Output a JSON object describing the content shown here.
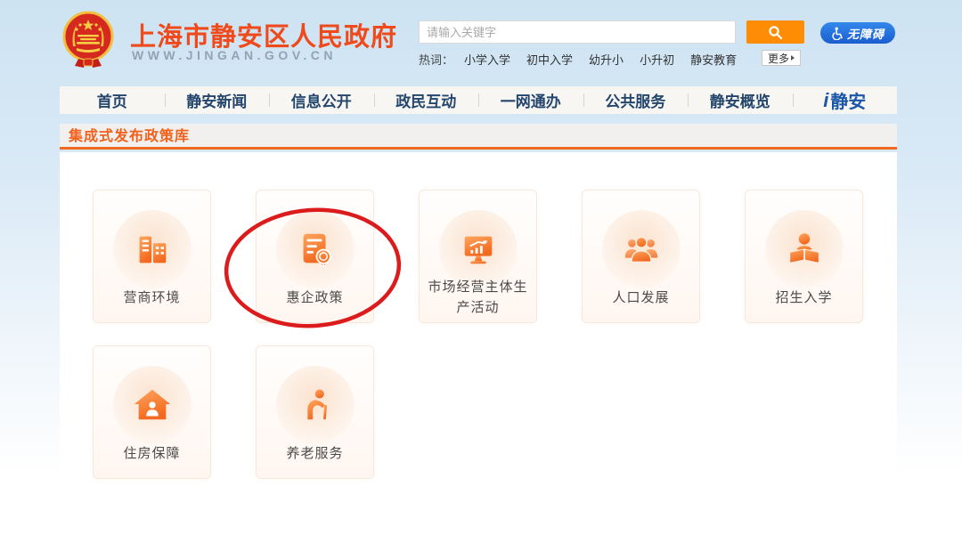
{
  "header": {
    "site_title": "上海市静安区人民政府",
    "site_url": "WWW.JINGAN.GOV.CN",
    "search": {
      "placeholder": "请输入关键字",
      "more_label": "更多"
    },
    "hot_words": {
      "label": "热词：",
      "items": [
        "小学入学",
        "初中入学",
        "幼升小",
        "小升初",
        "静安教育"
      ]
    },
    "accessibility_label": "无障碍"
  },
  "nav": {
    "items": [
      "首页",
      "静安新闻",
      "信息公开",
      "政民互动",
      "一网通办",
      "公共服务",
      "静安概览"
    ],
    "logo_prefix": "i",
    "logo_text": "静安"
  },
  "section": {
    "title": "集成式发布政策库"
  },
  "cards": [
    {
      "label": "营商环境",
      "icon": "buildings-icon"
    },
    {
      "label": "惠企政策",
      "icon": "policy-document-icon",
      "highlighted": true
    },
    {
      "label": "市场经营主体生产活动",
      "icon": "monitor-chart-icon"
    },
    {
      "label": "人口发展",
      "icon": "people-group-icon"
    },
    {
      "label": "招生入学",
      "icon": "student-reading-icon"
    },
    {
      "label": "住房保障",
      "icon": "house-person-icon"
    },
    {
      "label": "养老服务",
      "icon": "elderly-care-icon"
    }
  ],
  "colors": {
    "accent_orange": "#ef6a1e",
    "title_red": "#ef4a1b",
    "nav_text": "#24466c",
    "accessibility_blue": "#1a5ecf",
    "highlight_circle_red": "#dc1c1c",
    "search_button_orange": "#ff8c05"
  }
}
